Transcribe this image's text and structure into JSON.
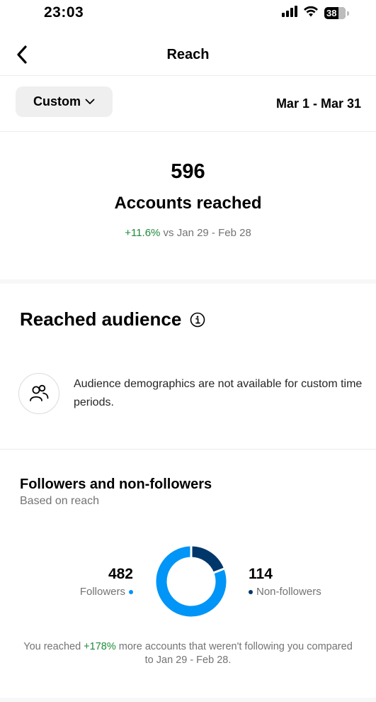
{
  "status_bar": {
    "time": "23:03",
    "battery": "38",
    "icons": [
      "signal-icon",
      "wifi-icon",
      "battery-icon"
    ]
  },
  "nav": {
    "title": "Reach",
    "back_icon": "chevron-left-icon"
  },
  "filter": {
    "preset_label": "Custom",
    "preset_icon": "chevron-down-icon",
    "date_range": "Mar 1 - Mar 31"
  },
  "summary": {
    "count": "596",
    "label": "Accounts reached",
    "change": "+11.6%",
    "comparison": " vs Jan 29 - Feb 28"
  },
  "audience": {
    "heading": "Reached audience",
    "info_icon": "info-icon",
    "people_icon": "people-icon",
    "notice": "Audience demographics are not available for custom time periods."
  },
  "followers_section": {
    "title": "Followers and non-followers",
    "subtitle": "Based on reach",
    "note_prefix": "You reached ",
    "note_highlight": "+178%",
    "note_suffix": " more accounts that weren't following you compared to Jan 29 - Feb 28."
  },
  "chart_data": {
    "type": "pie",
    "categories": [
      "Followers",
      "Non-followers"
    ],
    "values": [
      482,
      114
    ],
    "value_labels": [
      "482",
      "114"
    ],
    "colors": [
      "#0095f6",
      "#00376b"
    ],
    "donut": true,
    "legend": "sides"
  },
  "colors": {
    "accent_positive": "#1f8a3a",
    "followers": "#0095f6",
    "non_followers": "#00376b"
  }
}
